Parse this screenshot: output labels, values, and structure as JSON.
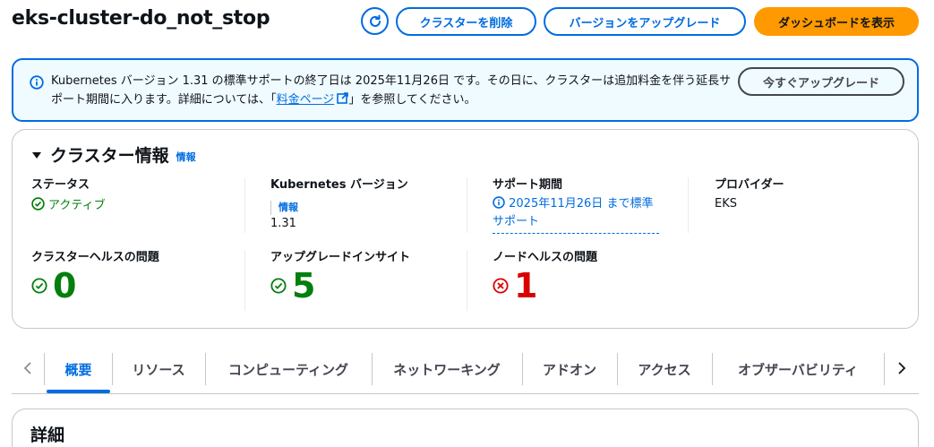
{
  "header": {
    "title": "eks-cluster-do_not_stop",
    "delete_label": "クラスターを削除",
    "upgrade_label": "バージョンをアップグレード",
    "dashboard_label": "ダッシュボードを表示"
  },
  "banner": {
    "text_before": "Kubernetes バージョン 1.31 の標準サポートの終了日は 2025年11月26日 です。その日に、クラスターは追加料金を伴う延長サポート期間に入ります。詳細については、「",
    "link_text": "料金ページ",
    "text_after": "」を参照してください。",
    "button_label": "今すぐアップグレード"
  },
  "cluster_info": {
    "title": "クラスター情報",
    "info_link": "情報",
    "status_label": "ステータス",
    "status_value": "アクティブ",
    "k8s_label": "Kubernetes バージョン",
    "k8s_info_link": "情報",
    "k8s_value": "1.31",
    "support_label": "サポート期間",
    "support_value": "2025年11月26日 まで標準サポート",
    "provider_label": "プロバイダー",
    "provider_value": "EKS",
    "health_label": "クラスターヘルスの問題",
    "health_value": "0",
    "insights_label": "アップグレードインサイト",
    "insights_value": "5",
    "node_label": "ノードヘルスの問題",
    "node_value": "1"
  },
  "tabs": [
    {
      "label": "概要"
    },
    {
      "label": "リソース"
    },
    {
      "label": "コンピューティング"
    },
    {
      "label": "ネットワーキング"
    },
    {
      "label": "アドオン"
    },
    {
      "label": "アクセス"
    },
    {
      "label": "オブザーバビリティ"
    }
  ],
  "details": {
    "title": "詳細"
  },
  "colors": {
    "accent": "#006ce0",
    "primary_button": "#ff9900",
    "success": "#037f0c",
    "error": "#db0000",
    "banner_bg": "#f0fbff"
  }
}
